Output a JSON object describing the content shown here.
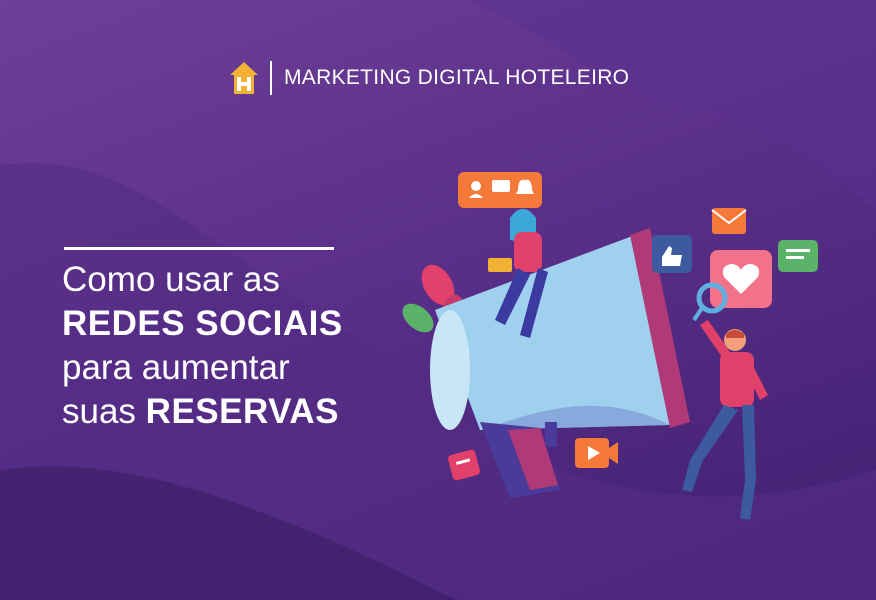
{
  "brand": {
    "name": "MARKETING DIGITAL HOTELEIRO",
    "logo_letter": "H",
    "logo_color": "#f2b134"
  },
  "headline": {
    "line1": "Como usar as",
    "line2_bold": "REDES SOCIAIS",
    "line3": "para aumentar",
    "line4_normal": "suas",
    "line4_bold": "RESERVAS"
  },
  "illustration": {
    "subject": "megaphone-with-social-media-icons",
    "icons": [
      "user-icon",
      "chat-icon",
      "bell-icon",
      "like-icon",
      "heart-icon",
      "mail-icon",
      "message-icon",
      "video-icon",
      "search-magnifier-icon"
    ]
  },
  "colors": {
    "background_top": "#6e3f96",
    "background_bottom": "#3e1f6e",
    "accent_orange": "#f57a3a",
    "accent_pink": "#e0406a",
    "megaphone_blue": "#9fd0ee"
  }
}
